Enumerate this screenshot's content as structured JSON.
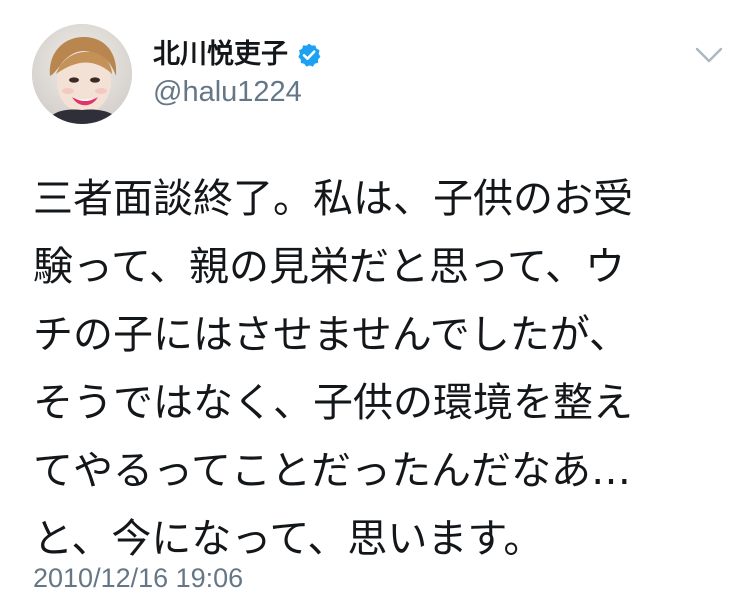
{
  "tweet": {
    "author": {
      "display_name": "北川悦吏子",
      "handle": "@halu1224",
      "verified": true,
      "avatar_icon": "profile-photo"
    },
    "menu_icon": "chevron-down-icon",
    "text_lines": [
      "三者面談終了。私は、子供のお受",
      "験って、親の見栄だと思って、ウ",
      "チの子にはさせませんでしたが、",
      "そうではなく、子供の環境を整え",
      "てやるってことだったんだなあ…",
      "と、今になって、思います。"
    ],
    "timestamp": "2010/12/16 19:06"
  },
  "colors": {
    "text_primary": "#14171a",
    "text_secondary": "#657786",
    "verified_blue": "#1da1f2",
    "chevron_gray": "#aab8c2"
  }
}
